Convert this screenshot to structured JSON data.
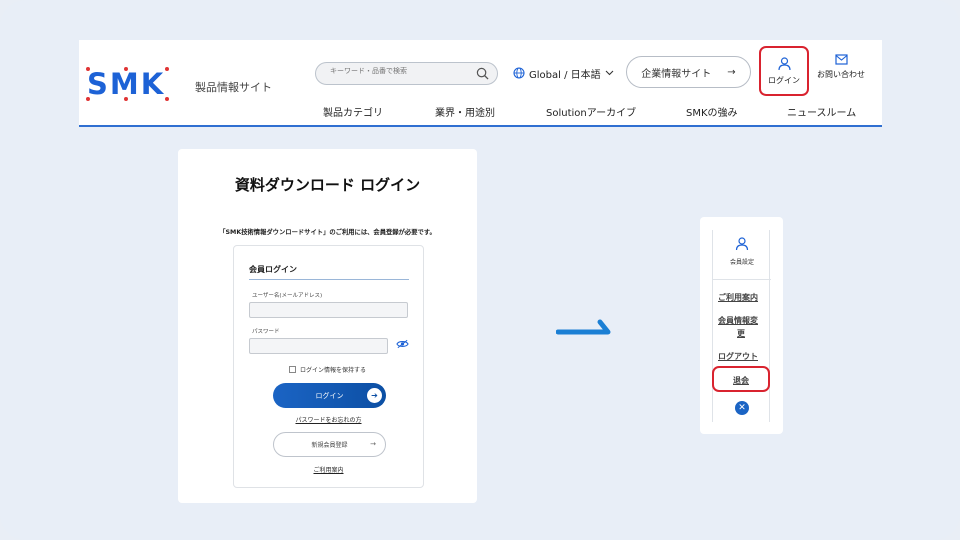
{
  "header": {
    "logo_text": "SMK",
    "site_name": "製品情報サイト",
    "search_placeholder": "キーワード・品番で検索",
    "language": "Global / 日本語",
    "corporate_button": "企業情報サイト",
    "login": "ログイン",
    "contact": "お問い合わせ",
    "nav": [
      "製品カテゴリ",
      "業界・用途別",
      "Solutionアーカイブ",
      "SMKの強み",
      "ニュースルーム"
    ]
  },
  "login_card": {
    "title": "資料ダウンロード ログイン",
    "notice": "「SMK技術情報ダウンロードサイト」のご利用には、会員登録が必要です。",
    "section_title": "会員ログイン",
    "username_label": "ユーザー名(メールアドレス)",
    "password_label": "パスワード",
    "remember_label": "ログイン情報を保持する",
    "login_button": "ログイン",
    "forgot_link": "パスワードをお忘れの方",
    "register_button": "新規会員登録",
    "guide_link": "ご利用案内"
  },
  "member_menu": {
    "label": "会員設定",
    "items": [
      "ご利用案内",
      "会員情報変",
      "更",
      "ログアウト",
      "退会"
    ]
  },
  "colors": {
    "brand": "#1d62d6",
    "highlight": "#d9232f",
    "button_blue": "#1b64c4"
  }
}
